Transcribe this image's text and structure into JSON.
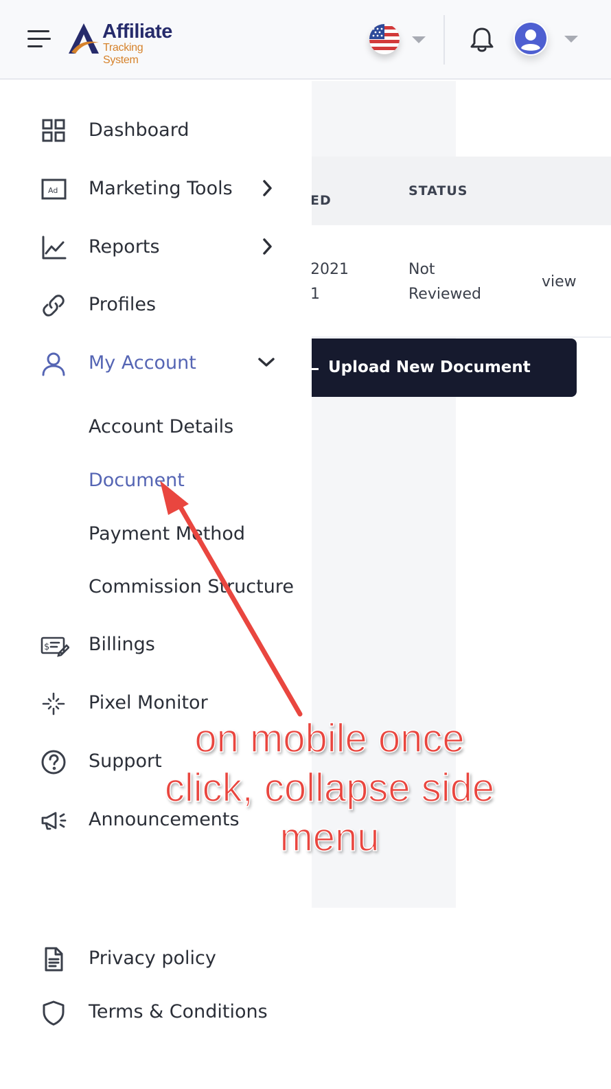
{
  "header": {
    "logo_title": "Affiliate",
    "logo_subtitle": "Tracking System",
    "flag_icon": "us-flag-icon",
    "colors": {
      "logo_navy": "#262b6b",
      "logo_orange": "#d6822b",
      "avatar_blue": "#4e5fd1"
    }
  },
  "table": {
    "column_partial": "ED",
    "column_status": "STATUS",
    "row": {
      "date_line1": "2021",
      "date_line2": "1",
      "status_line1": "Not",
      "status_line2": "Reviewed",
      "action": "view"
    }
  },
  "upload_button": {
    "label": "Upload New Document"
  },
  "sidebar": {
    "items": [
      {
        "label": "Dashboard",
        "icon": "grid-icon"
      },
      {
        "label": "Marketing Tools",
        "icon": "ad-icon"
      },
      {
        "label": "Reports",
        "icon": "chart-line-icon"
      },
      {
        "label": "Profiles",
        "icon": "link-icon"
      },
      {
        "label": "My Account",
        "icon": "user-icon"
      },
      {
        "label": "Billings",
        "icon": "billing-icon"
      },
      {
        "label": "Pixel Monitor",
        "icon": "pixel-icon"
      },
      {
        "label": "Support",
        "icon": "help-circle-icon"
      },
      {
        "label": "Announcements",
        "icon": "megaphone-icon"
      }
    ],
    "my_account_sub": [
      {
        "label": "Account Details"
      },
      {
        "label": "Document"
      },
      {
        "label": "Payment Method"
      },
      {
        "label": "Commission Structure"
      }
    ],
    "footer": [
      {
        "label": "Privacy policy",
        "icon": "document-icon"
      },
      {
        "label": "Terms & Conditions",
        "icon": "shield-icon"
      }
    ],
    "colors": {
      "active": "#5565b4",
      "text": "#2b2f38"
    }
  },
  "annotation": {
    "lines": [
      "on mobile once",
      "click, collapse side",
      "menu"
    ],
    "color": "#e9463f"
  }
}
